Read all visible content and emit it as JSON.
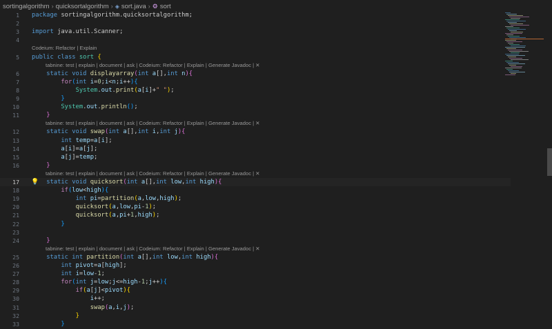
{
  "breadcrumb": {
    "items": [
      "sortingalgorithm",
      "quicksortalgorithm",
      "sort.java",
      "sort"
    ],
    "icons": [
      "java-file-icon",
      "class-symbol-icon"
    ]
  },
  "editor": {
    "active_line": "17",
    "lines": [
      {
        "n": "1",
        "html": "<span class='k'>package</span> <span class='p'>sortingalgorithm.quicksortalgorithm;</span>"
      },
      {
        "n": "2",
        "html": ""
      },
      {
        "n": "3",
        "html": "<span class='k'>import</span> <span class='p'>java.util.Scanner;</span>"
      },
      {
        "n": "4",
        "html": ""
      },
      {
        "n": "5",
        "html": "<span class='k'>public</span> <span class='k'>class</span> <span class='t'>sort</span> <span class='b1'>{</span>"
      },
      {
        "n": "6",
        "html": "    <span class='k'>static</span> <span class='k'>void</span> <span class='f'>displayarray</span><span class='b2'>(</span><span class='k'>int</span> <span class='v'>a</span>[],<span class='k'>int</span> <span class='v'>n</span><span class='b2'>)</span><span class='b2'>{</span>"
      },
      {
        "n": "7",
        "html": "        <span class='ctrl'>for</span><span class='b3'>(</span><span class='k'>int</span> <span class='v'>i</span>=<span class='n'>0</span>;<span class='v'>i</span>&lt;<span class='v'>n</span>;<span class='v'>i</span>++<span class='b3'>)</span><span class='b3'>{</span>"
      },
      {
        "n": "8",
        "html": "            <span class='t'>System</span>.<span class='v'>out</span>.<span class='f'>print</span><span class='b1'>(</span><span class='v'>a</span>[<span class='v'>i</span>]+<span class='s'>\" \"</span><span class='b1'>)</span>;"
      },
      {
        "n": "9",
        "html": "        <span class='b3'>}</span>"
      },
      {
        "n": "10",
        "html": "        <span class='t'>System</span>.<span class='v'>out</span>.<span class='f'>println</span><span class='b3'>()</span>;"
      },
      {
        "n": "11",
        "html": "    <span class='b2'>}</span>"
      },
      {
        "n": "12",
        "html": "    <span class='k'>static</span> <span class='k'>void</span> <span class='f'>swap</span><span class='b2'>(</span><span class='k'>int</span> <span class='v'>a</span>[],<span class='k'>int</span> <span class='v'>i</span>,<span class='k'>int</span> <span class='v'>j</span><span class='b2'>)</span><span class='b2'>{</span>"
      },
      {
        "n": "13",
        "html": "        <span class='k'>int</span> <span class='v'>temp</span>=<span class='v'>a</span>[<span class='v'>i</span>];"
      },
      {
        "n": "14",
        "html": "        <span class='v'>a</span>[<span class='v'>i</span>]=<span class='v'>a</span>[<span class='v'>j</span>];"
      },
      {
        "n": "15",
        "html": "        <span class='v'>a</span>[<span class='v'>j</span>]=<span class='v'>temp</span>;"
      },
      {
        "n": "16",
        "html": "    <span class='b2'>}</span>"
      },
      {
        "n": "17",
        "html": "    <span class='k'>static</span> <span class='k'>void</span> <span class='f'>quicksort</span><span class='b2'>(</span><span class='k'>int</span> <span class='v'>a</span>[],<span class='k'>int</span> <span class='v'>low</span>,<span class='k'>int</span> <span class='v'>high</span><span class='b2'>)</span><span class='b2'>{</span>"
      },
      {
        "n": "18",
        "html": "        <span class='ctrl'>if</span><span class='b3'>(</span><span class='v'>low</span>&lt;<span class='v'>high</span><span class='b3'>)</span><span class='b3'>{</span>"
      },
      {
        "n": "19",
        "html": "            <span class='k'>int</span> <span class='v'>pi</span>=<span class='f'>partition</span><span class='b1'>(</span><span class='v'>a</span>,<span class='v'>low</span>,<span class='v'>high</span><span class='b1'>)</span>;"
      },
      {
        "n": "20",
        "html": "            <span class='f'>quicksort</span><span class='b1'>(</span><span class='v'>a</span>,<span class='v'>low</span>,<span class='v'>pi</span>-<span class='n'>1</span><span class='b1'>)</span>;"
      },
      {
        "n": "21",
        "html": "            <span class='f'>quicksort</span><span class='b1'>(</span><span class='v'>a</span>,<span class='v'>pi</span>+<span class='n'>1</span>,<span class='v'>high</span><span class='b1'>)</span>;"
      },
      {
        "n": "22",
        "html": "        <span class='b3'>}</span>"
      },
      {
        "n": "23",
        "html": ""
      },
      {
        "n": "24",
        "html": "    <span class='b2'>}</span>"
      },
      {
        "n": "25",
        "html": "    <span class='k'>static</span> <span class='k'>int</span> <span class='f'>partition</span><span class='b2'>(</span><span class='k'>int</span> <span class='v'>a</span>[],<span class='k'>int</span> <span class='v'>low</span>,<span class='k'>int</span> <span class='v'>high</span><span class='b2'>)</span><span class='b2'>{</span>"
      },
      {
        "n": "26",
        "html": "        <span class='k'>int</span> <span class='v'>pivot</span>=<span class='v'>a</span>[<span class='v'>high</span>];"
      },
      {
        "n": "27",
        "html": "        <span class='k'>int</span> <span class='v'>i</span>=<span class='v'>low</span>-<span class='n'>1</span>;"
      },
      {
        "n": "28",
        "html": "        <span class='ctrl'>for</span><span class='b3'>(</span><span class='k'>int</span> <span class='v'>j</span>=<span class='v'>low</span>;<span class='v'>j</span>&lt;=<span class='v'>high</span>-<span class='n'>1</span>;<span class='v'>j</span>++<span class='b3'>)</span><span class='b3'>{</span>"
      },
      {
        "n": "29",
        "html": "            <span class='ctrl'>if</span><span class='b1'>(</span><span class='v'>a</span>[<span class='v'>j</span>]&lt;<span class='v'>pivot</span><span class='b1'>)</span><span class='b1'>{</span>"
      },
      {
        "n": "30",
        "html": "                <span class='v'>i</span>++;"
      },
      {
        "n": "31",
        "html": "                <span class='f'>swap</span><span class='b2'>(</span><span class='v'>a</span>,<span class='v'>i</span>,<span class='v'>j</span><span class='b2'>)</span>;"
      },
      {
        "n": "32",
        "html": "            <span class='b1'>}</span>"
      },
      {
        "n": "33",
        "html": "        <span class='b3'>}</span>"
      }
    ]
  },
  "codelens": {
    "codeium_class": "Codeium: Refactor | Explain",
    "tabnine_method": "tabnine: test | explain | document | ask | Codeium: Refactor | Explain | Generate Javadoc | ✕"
  }
}
